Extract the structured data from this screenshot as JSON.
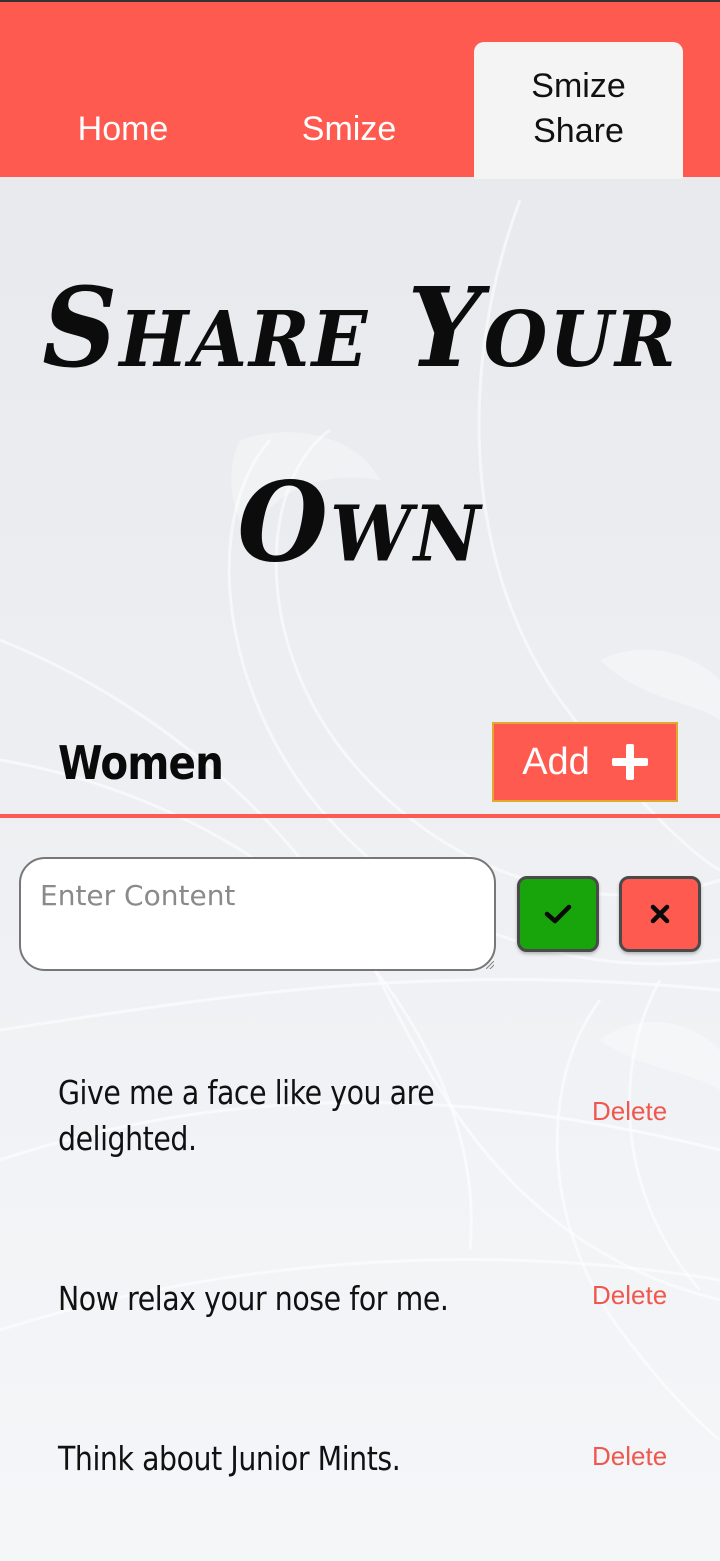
{
  "nav": {
    "tabs": [
      {
        "label": "Home"
      },
      {
        "label": "Smize"
      },
      {
        "label_line1": "Smize",
        "label_line2": "Share"
      }
    ]
  },
  "hero": {
    "line1": "Share Your",
    "line2": "Own"
  },
  "section": {
    "title": "Women",
    "add_label": "Add"
  },
  "form": {
    "placeholder": "Enter Content",
    "value": ""
  },
  "items": [
    {
      "text": "Give me a face like you are delighted.",
      "action": "Delete"
    },
    {
      "text": "Now relax your nose for me.",
      "action": "Delete"
    },
    {
      "text": "Think about Junior Mints.",
      "action": "Delete"
    }
  ],
  "colors": {
    "accent": "#fe5a50",
    "confirm": "#18a40b",
    "active_tab_bg": "#f4f4f4"
  },
  "icons": {
    "add": "plus-icon",
    "confirm": "check-icon",
    "cancel": "x-icon"
  }
}
